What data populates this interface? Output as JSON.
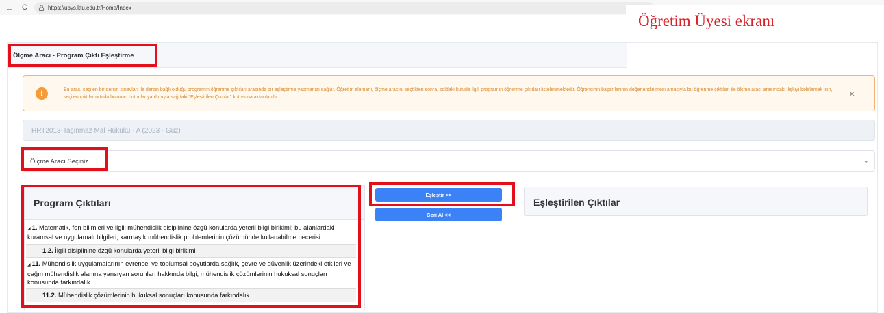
{
  "browser": {
    "back_icon": "←",
    "reload_icon": "C",
    "url": "https://ubys.ktu.edu.tr/Home/Index"
  },
  "caption": "Öğretim Üyesi ekranı",
  "page": {
    "tab_title": "Ölçme Aracı - Program Çıktı Eşleştirme",
    "alert": {
      "icon": "i",
      "text": "Bu araç, seçilen bir dersin sınavları ile dersin bağlı olduğu programın öğrenme çıktıları arasında bir eşleştirme yapmanızı sağlar. Öğretim elemanı, ölçme aracını seçtikten sonra, soldaki kutuda ilgili programın öğrenme çıktıları listelenmektedir. Öğrencinin başarılarının değerlendirilmesi amacıyla bu öğrenme çıktıları ile ölçme aracı arasındaki ilişkiyi belirlemek için, seçilen çıktılar ortada bulunan butonlar yardımıyla sağdaki \"Eşleştirilen Çıktılar\" kutusuna aktarılabilir.",
      "close": "×"
    },
    "course": "HRT2013-Taşınmaz Mal Hukuku - A (2023 - Güz)",
    "select_label": "Ölçme Aracı Seçiniz",
    "select_chevron": "⌄",
    "program_outputs": {
      "title": "Program Çıktıları",
      "items": [
        {
          "num": "1.",
          "text": " Matematik, fen bilimleri ve ilgili mühendislik disiplinine özgü konularda yeterli bilgi birikimi; bu alanlardaki kuramsal ve uygulamalı bilgileri, karmaşık mühendislik problemlerinin çözümünde kullanabilme becerisi."
        },
        {
          "num": "1.2.",
          "text": " İlgili disiplinine özgü konularda yeterli bilgi birikimi"
        },
        {
          "num": "11.",
          "text": " Mühendislik uygulamalarının evrensel ve toplumsal boyutlarda sağlık, çevre ve güvenlik üzerindeki etkileri ve çağın mühendislik alanına yansıyan sorunları hakkında bilgi; mühendislik çözümlerinin hukuksal sonuçları konusunda farkındalık."
        },
        {
          "num": "11.2.",
          "text": " Mühendislik çözümlerinin hukuksal sonuçları konusunda farkındalık"
        }
      ]
    },
    "buttons": {
      "match": "Eşleştir >>",
      "undo": "Geri Al <<"
    },
    "matched_outputs": {
      "title": "Eşleştirilen Çıktılar"
    }
  },
  "colors": {
    "highlight": "#e3101c",
    "button": "#3b82f6",
    "alert_border": "#f6b26b",
    "caption": "#d8222a"
  }
}
